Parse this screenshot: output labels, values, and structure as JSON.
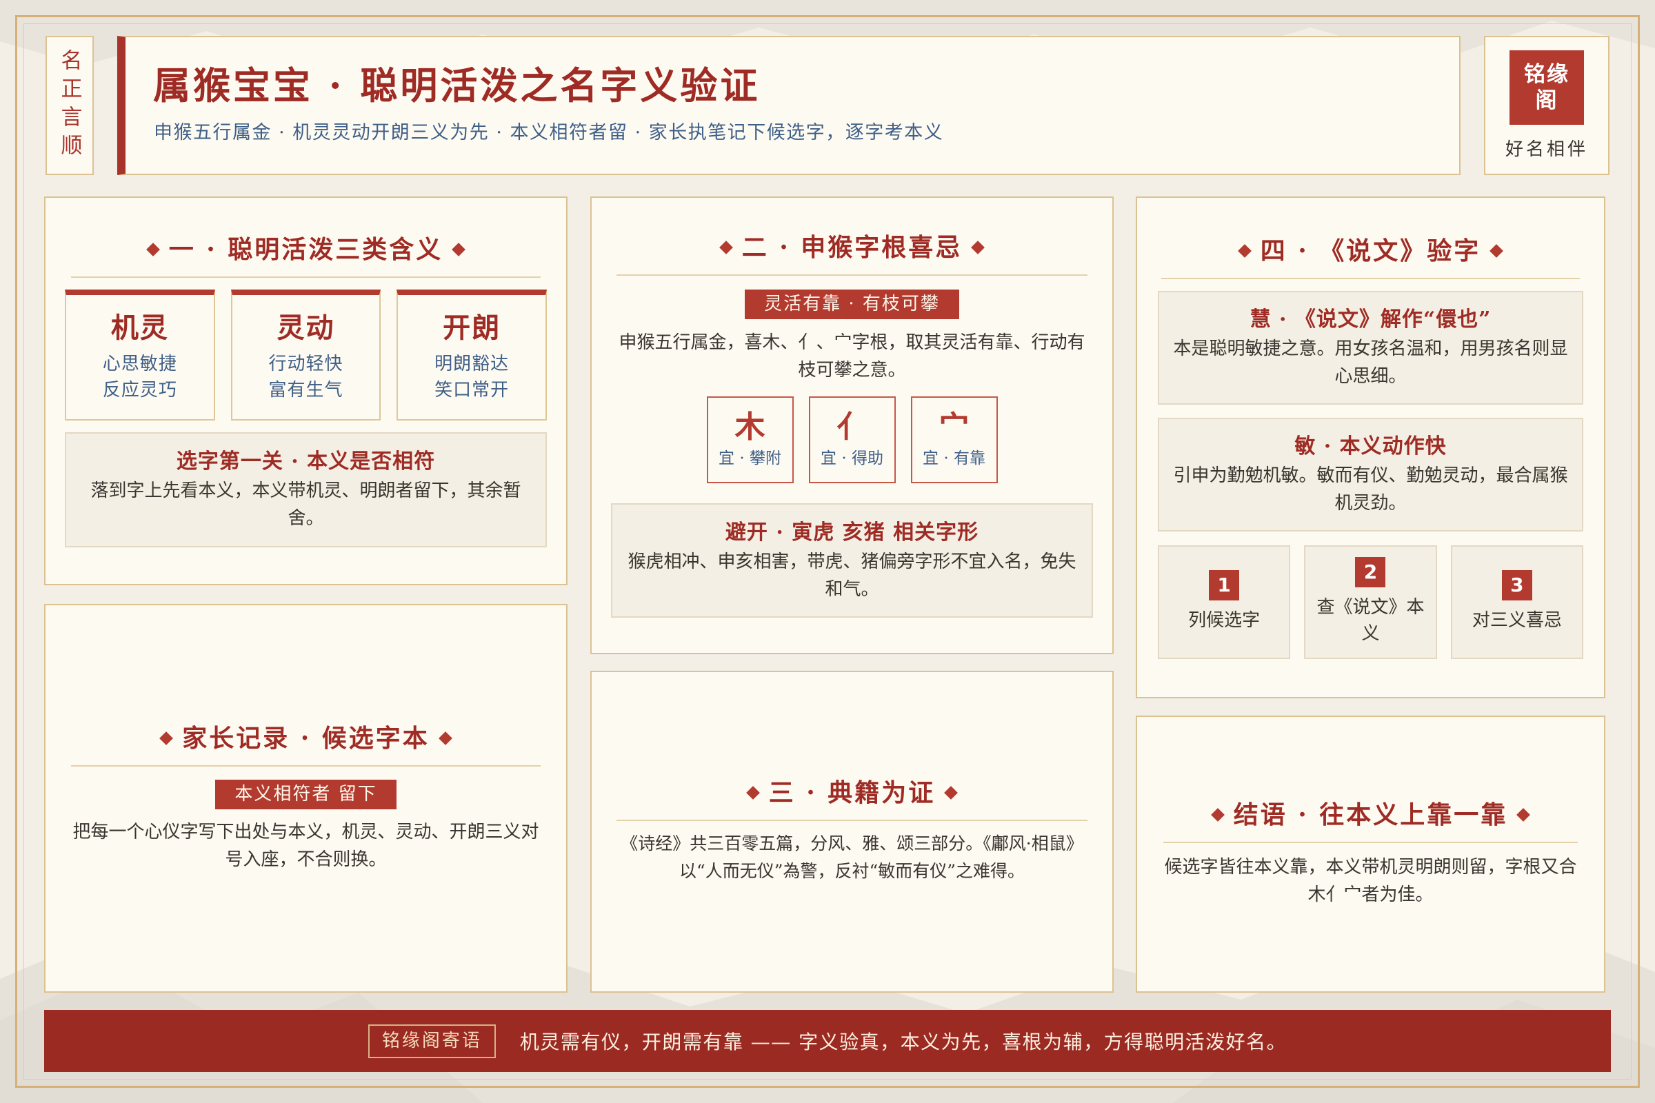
{
  "colors": {
    "accent_red": "#b23a2f",
    "title_red": "#9e2b24",
    "gold": "#dcc292",
    "ink_blue": "#3f5f87",
    "footer_red": "#9b2a22",
    "paper": "#fdfaf2"
  },
  "icons": {
    "heading_ornament": "diamond-icon"
  },
  "header": {
    "vertical_seal": "名正言顺",
    "title": "属猴宝宝 · 聪明活泼之名字义验证",
    "subtitle": "申猴五行属金 · 机灵灵动开朗三义为先 · 本义相符者留 · 家长执笔记下候选字，逐字考本义",
    "brand_seal_line1": "铭缘",
    "brand_seal_line2": "阁",
    "brand_tagline": "好名相伴"
  },
  "meanings": {
    "heading": "一 · 聪明活泼三类含义",
    "cards": [
      {
        "title": "机灵",
        "line1": "心思敏捷",
        "line2": "反应灵巧"
      },
      {
        "title": "灵动",
        "line1": "行动轻快",
        "line2": "富有生气"
      },
      {
        "title": "开朗",
        "line1": "明朗豁达",
        "line2": "笑口常开"
      }
    ],
    "note_title": "选字第一关 · 本义是否相符",
    "note_body": "落到字上先看本义，本义带机灵、明朗者留下，其余暂舍。"
  },
  "radicals": {
    "heading": "二 · 申猴字根喜忌",
    "tag": "灵活有靠 · 有枝可攀",
    "description": "申猴五行属金，喜木、亻、宀字根，取其灵活有靠、行动有枝可攀之意。",
    "items": [
      {
        "char": "木",
        "note": "宜 · 攀附"
      },
      {
        "char": "亻",
        "note": "宜 · 得助"
      },
      {
        "char": "宀",
        "note": "宜 · 有靠"
      }
    ],
    "avoid_title": "避开 · 寅虎 亥猪 相关字形",
    "avoid_body": "猴虎相冲、申亥相害，带虎、猪偏旁字形不宜入名，免失和气。"
  },
  "classics": {
    "heading": "三 · 典籍为证",
    "body": "《诗经》共三百零五篇，分风、雅、颂三部分。《鄘风·相鼠》以“人而无仪”為警，反衬“敏而有仪”之难得。"
  },
  "shuowen": {
    "heading": "四 · 《说文》验字",
    "entries": [
      {
        "title": "慧 · 《说文》解作“儇也”",
        "body": "本是聪明敏捷之意。用女孩名温和，用男孩名则显心思细。"
      },
      {
        "title": "敏 · 本义动作快",
        "body": "引申为勤勉机敏。敏而有仪、勤勉灵动，最合属猴机灵劲。"
      }
    ],
    "steps": [
      {
        "number": "1",
        "label": "列候选字"
      },
      {
        "number": "2",
        "label": "查《说文》本义"
      },
      {
        "number": "3",
        "label": "对三义喜忌"
      }
    ]
  },
  "parent_record": {
    "heading": "家长记录 · 候选字本",
    "tag": "本义相符者 留下",
    "body": "把每一个心仪字写下出处与本义，机灵、灵动、开朗三义对号入座，不合则换。"
  },
  "conclusion": {
    "heading": "结语 · 往本义上靠一靠",
    "body": "候选字皆往本义靠，本义带机灵明朗则留，字根又合木亻宀者为佳。"
  },
  "footer": {
    "label": "铭缘阁寄语",
    "message": "机灵需有仪，开朗需有靠 —— 字义验真，本义为先，喜根为辅，方得聪明活泼好名。"
  }
}
